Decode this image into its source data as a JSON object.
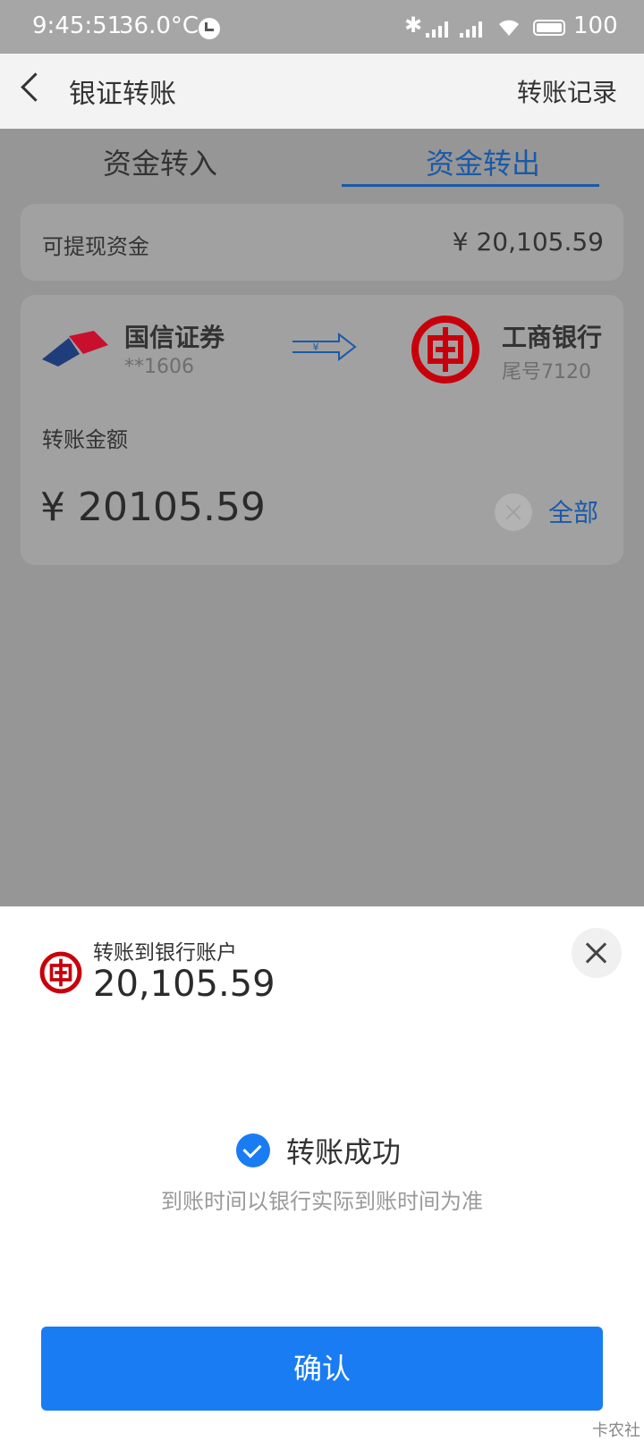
{
  "status_bar": {
    "time": "9:45:51",
    "temperature": "36.0°C",
    "battery": "100"
  },
  "header": {
    "title": "银证转账",
    "records": "转账记录"
  },
  "tabs": {
    "transfer_in": "资金转入",
    "transfer_out": "资金转出",
    "active": "资金转出"
  },
  "withdrawable": {
    "label": "可提现资金",
    "value": "¥ 20,105.59"
  },
  "transfer": {
    "from": {
      "name": "国信证券",
      "account": "**1606"
    },
    "to": {
      "name": "工商银行",
      "tail": "尾号7120"
    },
    "arrow_symbol": "¥",
    "amount_label": "转账金额",
    "amount_value": "¥ 20105.59",
    "all_label": "全部"
  },
  "sheet": {
    "label": "转账到银行账户",
    "amount": "20,105.59",
    "success": "转账成功",
    "note": "到账时间以银行实际到账时间为准",
    "confirm": "确认"
  },
  "watermark": "卡农社",
  "colors": {
    "accent_blue": "#1a7cf3",
    "tab_blue": "#1a5aa8",
    "icbc_red": "#c7000b",
    "guosen_red": "#c8102e",
    "guosen_blue": "#1f3d7a"
  }
}
